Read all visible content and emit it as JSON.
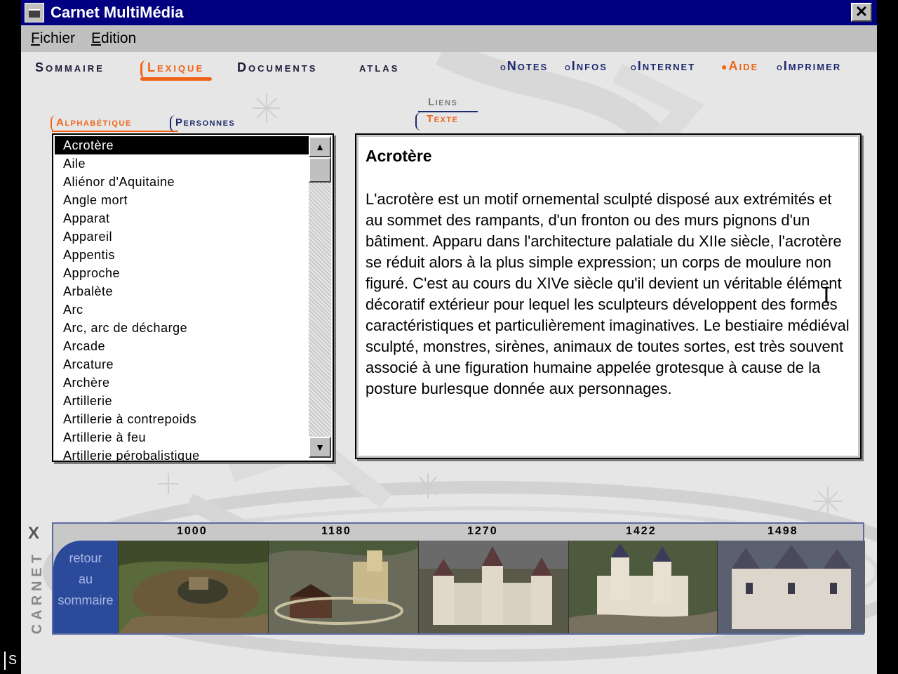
{
  "window": {
    "title": "Carnet MultiMédia",
    "close_symbol": "✕"
  },
  "menu": {
    "fichier": "ichier",
    "fichier_mnemonic": "F",
    "edition": "dition",
    "edition_mnemonic": "E"
  },
  "left_strip": {
    "label": "S"
  },
  "nav": {
    "sommaire": "Sommaire",
    "lexique": "Lexique",
    "documents": "Documents",
    "atlas": "atlas"
  },
  "right_nav": {
    "notes": "Notes",
    "infos": "Infos",
    "internet": "Internet",
    "aide": "Aide",
    "imprimer": "Imprimer"
  },
  "subtabs": {
    "alphabetique": "Alphabétique",
    "personnes": "Personnes",
    "liens": "Liens",
    "texte": "Texte"
  },
  "list": {
    "items": [
      "Acrotère",
      "Aile",
      "Aliénor d'Aquitaine",
      "Angle mort",
      "Apparat",
      "Appareil",
      "Appentis",
      "Approche",
      "Arbalète",
      "Arc",
      "Arc, arc de décharge",
      "Arcade",
      "Arcature",
      "Archère",
      "Artillerie",
      "Artillerie à contrepoids",
      "Artillerie à feu",
      "Artillerie pérobalistique"
    ],
    "selected_index": 0,
    "scroll_up": "▲",
    "scroll_down": "▼"
  },
  "article": {
    "title": "Acrotère",
    "body": "L'acrotère est un motif ornemental sculpté disposé aux extrémités et au sommet des rampants, d'un fronton ou des murs pignons d'un bâtiment. Apparu dans l'architecture palatiale du XIIe siècle, l'acrotère se réduit alors à la plus simple expression; un corps de moulure non figuré. C'est au cours du XIVe siècle qu'il devient un véritable élément décoratif extérieur pour lequel les sculpteurs développent des formes caractéristiques et particulièrement imaginatives. Le bestiaire médiéval sculpté, monstres, sirènes, animaux de toutes sortes, est très souvent associé à une figuration humaine appelée grotesque à cause de la posture burlesque donnée aux personnages."
  },
  "timeline": {
    "return_lines": [
      "retour",
      "au",
      "sommaire"
    ],
    "years": [
      "1000",
      "1180",
      "1270",
      "1422",
      "1498"
    ]
  },
  "logo": {
    "letters": "CARNET",
    "mark": "X"
  },
  "colors": {
    "accent": "#f06418",
    "navy": "#1e2a6e",
    "titlebar": "#000080",
    "timeline_blue": "#2b4a9a"
  }
}
